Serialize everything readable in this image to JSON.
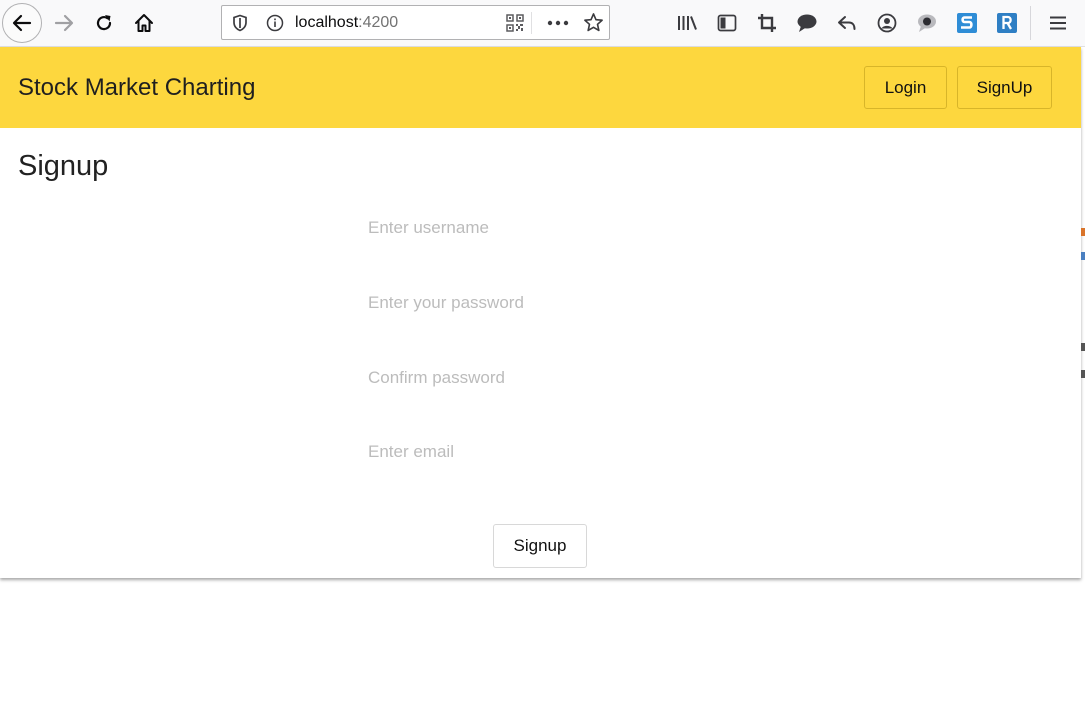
{
  "browser": {
    "url_host": "localhost",
    "url_port": ":4200"
  },
  "app": {
    "brand": "Stock Market Charting",
    "header_buttons": {
      "login": "Login",
      "signup": "SignUp"
    },
    "colors": {
      "header_background": "#fdd73e"
    }
  },
  "signup_form": {
    "title": "Signup",
    "fields": {
      "username": {
        "placeholder": "Enter username",
        "value": ""
      },
      "password": {
        "placeholder": "Enter your password",
        "value": ""
      },
      "confirm_password": {
        "placeholder": "Confirm password",
        "value": ""
      },
      "email": {
        "placeholder": "Enter email",
        "value": ""
      }
    },
    "submit_label": "Signup"
  }
}
